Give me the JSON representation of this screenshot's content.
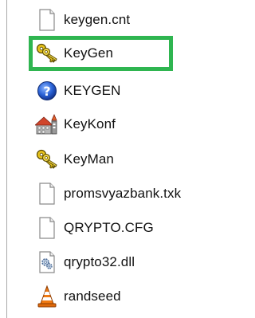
{
  "files": [
    {
      "name": "keygen.cnt",
      "icon": "document-icon"
    },
    {
      "name": "KeyGen",
      "icon": "keys-icon"
    },
    {
      "name": "KEYGEN",
      "icon": "help-file-icon"
    },
    {
      "name": "KeyKonf",
      "icon": "config-house-icon"
    },
    {
      "name": "KeyMan",
      "icon": "keys-icon"
    },
    {
      "name": "promsvyazbank.txk",
      "icon": "document-icon"
    },
    {
      "name": "QRYPTO.CFG",
      "icon": "document-icon"
    },
    {
      "name": "qrypto32.dll",
      "icon": "dll-gear-icon"
    },
    {
      "name": "randseed",
      "icon": "traffic-cone-icon"
    }
  ],
  "highlight": {
    "target": "KeyGen",
    "color": "#2fb550"
  }
}
